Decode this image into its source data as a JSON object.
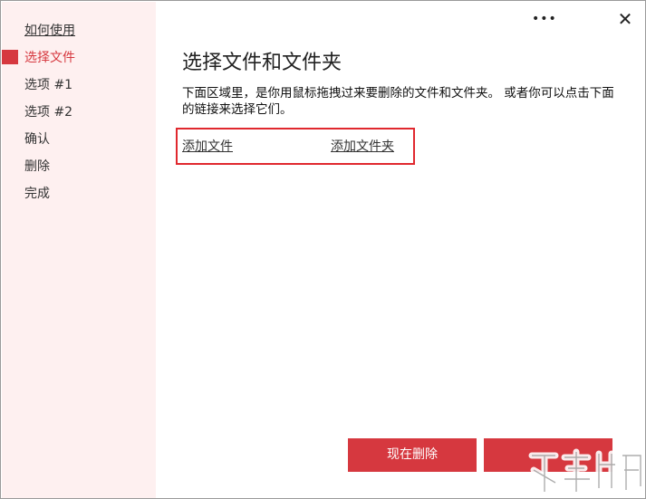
{
  "window": {
    "menu_icon": "more-options-icon",
    "close_icon": "close-icon",
    "menu_glyph": "•••",
    "close_glyph": "✕"
  },
  "sidebar": {
    "items": [
      {
        "label": "如何使用"
      },
      {
        "label": "选择文件"
      },
      {
        "label": "选项 #1"
      },
      {
        "label": "选项 #2"
      },
      {
        "label": "确认"
      },
      {
        "label": "删除"
      },
      {
        "label": "完成"
      }
    ]
  },
  "main": {
    "title": "选择文件和文件夹",
    "description": "下面区域里，是你用鼠标拖拽过来要删除的文件和文件夹。 或者你可以点击下面的链接来选择它们。",
    "add_file_link": "添加文件",
    "add_folder_link": "添加文件夹"
  },
  "footer": {
    "delete_now_label": "现在删除",
    "next_label": ""
  },
  "colors": {
    "accent": "#d6383f",
    "sidebar_bg": "#fef0f0",
    "highlight_box": "#e0282e"
  }
}
